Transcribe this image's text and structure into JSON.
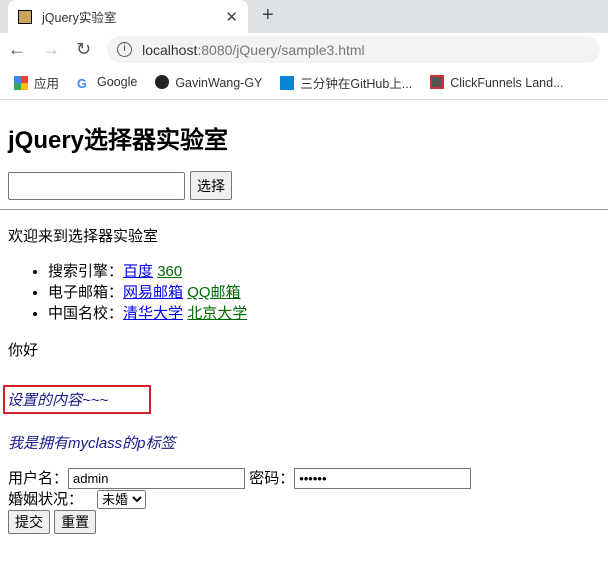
{
  "browser": {
    "tab_title": "jQuery实验室",
    "url_host": "localhost",
    "url_rest": ":8080/jQuery/sample3.html",
    "bookmarks": [
      "应用",
      "Google",
      "GavinWang-GY",
      "三分钟在GitHub上...",
      "ClickFunnels Land..."
    ]
  },
  "page": {
    "title": "jQuery选择器实验室",
    "select_button": "选择",
    "welcome": "欢迎来到选择器实验室",
    "list": [
      {
        "label": "搜索引擎：",
        "links": [
          "百度",
          "360"
        ]
      },
      {
        "label": "电子邮箱：",
        "links": [
          "网易邮箱",
          "QQ邮箱"
        ]
      },
      {
        "label": "中国名校：",
        "links": [
          "清华大学",
          "北京大学"
        ]
      }
    ],
    "hello": "你好",
    "set_content": "设置的内容~~~",
    "myclass_p": "我是拥有myclass的p标签",
    "form": {
      "username_label": "用户名：",
      "username_value": "admin",
      "password_label": "密码：",
      "password_value": "123456",
      "marital_label": "婚姻状况：",
      "marital_value": "未婚",
      "submit": "提交",
      "reset": "重置"
    }
  },
  "colors": {
    "highlight_border": "#d0212a",
    "link": "#0000ee",
    "link_alt": "#006600"
  }
}
